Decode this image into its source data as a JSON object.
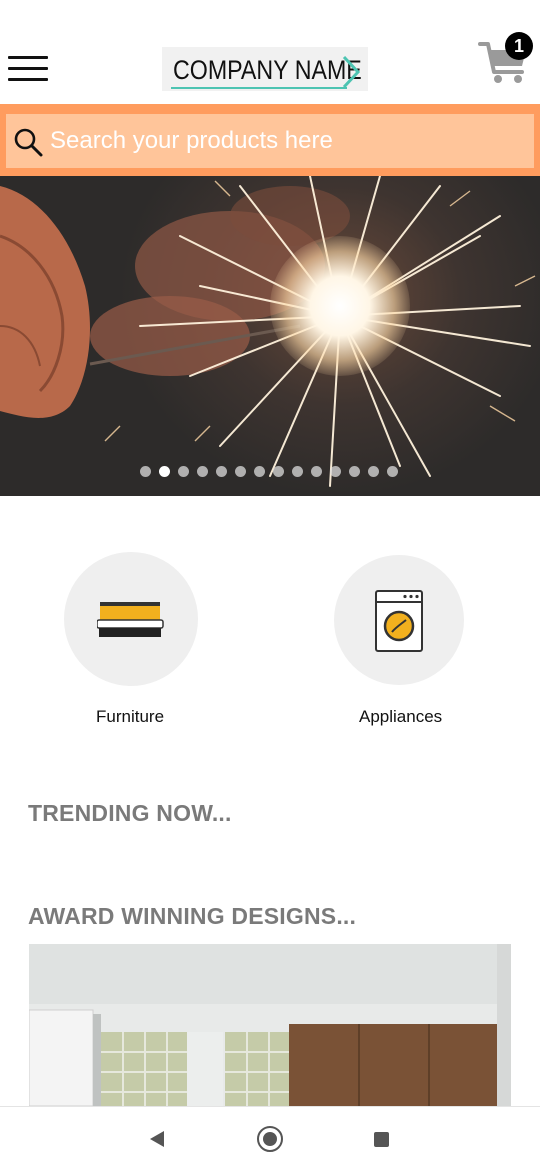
{
  "header": {
    "logo_text": "COMPANY NAME",
    "cart_count": "1",
    "icons": {
      "menu": "hamburger-menu-icon",
      "cart": "shopping-cart-icon"
    }
  },
  "search": {
    "placeholder": "Search your products here",
    "icon": "search-icon"
  },
  "banner": {
    "image": "sparkler-photo",
    "slide_count": 14,
    "active_slide": 2
  },
  "categories": [
    {
      "label": "Furniture",
      "icon": "bed-icon"
    },
    {
      "label": "Appliances",
      "icon": "washing-machine-icon"
    }
  ],
  "sections": {
    "trending_title": "TRENDING NOW...",
    "award_title": "AWARD WINNING DESIGNS..."
  },
  "system_nav": {
    "back": "back-icon",
    "home": "home-icon",
    "recent": "recent-apps-icon"
  },
  "colors": {
    "search_bar": "#ff9c5e",
    "search_field": "#ffc59a",
    "logo_accent": "#4dc4b2",
    "section_title": "#7a7a7a",
    "category_circle": "#efefef",
    "icon_accent": "#f2b01e"
  }
}
